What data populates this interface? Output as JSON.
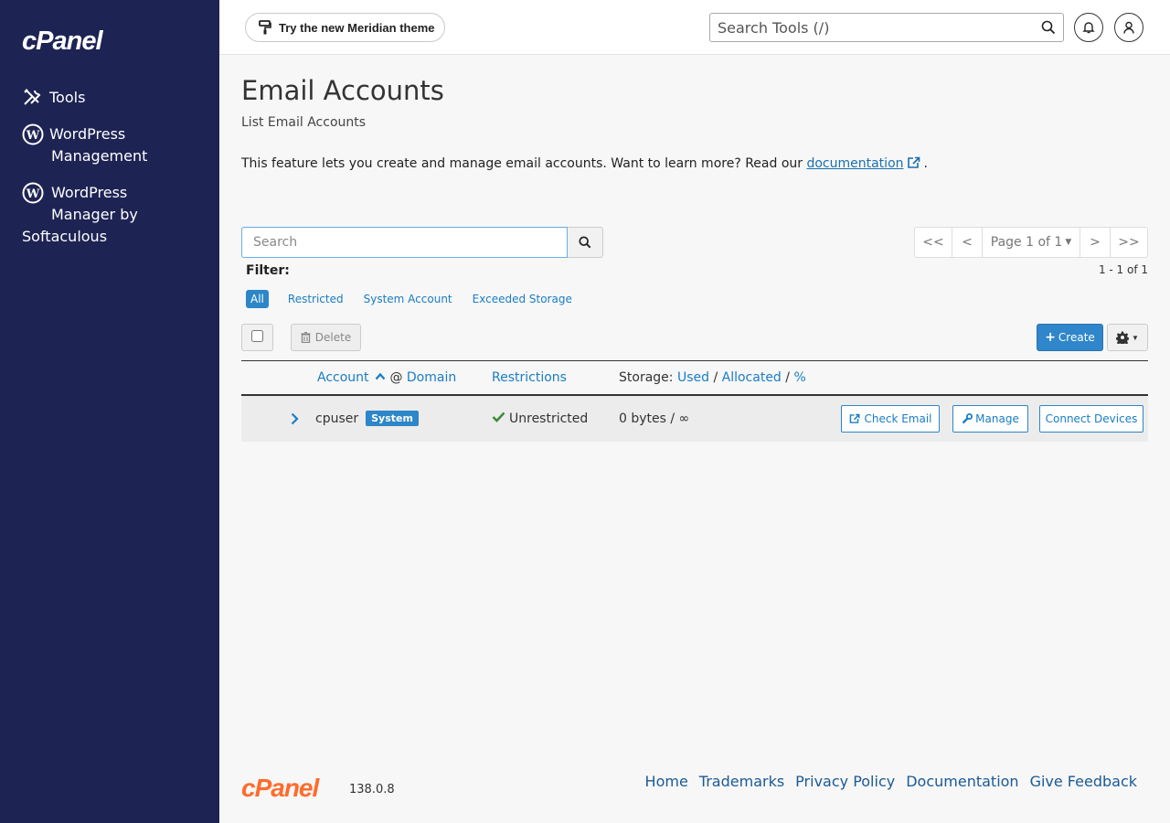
{
  "brand": {
    "logo_text": "cPanel",
    "version": "138.0.8"
  },
  "sidebar": {
    "items": [
      {
        "label": "Tools",
        "icon": "tools-icon"
      },
      {
        "label_line1": "WordPress",
        "label_line2": "Management",
        "icon": "wordpress-icon"
      },
      {
        "label_line1": "WordPress",
        "label_line2": "Manager by",
        "label_line3": "Softaculous",
        "icon": "wordpress-icon"
      }
    ]
  },
  "topbar": {
    "theme_button": "Try the new Meridian theme",
    "search_placeholder": "Search Tools (/)"
  },
  "page": {
    "title": "Email Accounts",
    "subtitle": "List Email Accounts",
    "intro_text": "This feature lets you create and manage email accounts. Want to learn more? Read our ",
    "intro_link": "documentation",
    "intro_end": "."
  },
  "list": {
    "search_placeholder": "Search",
    "pager": {
      "first": "<<",
      "prev": "<",
      "page_label": "Page 1 of 1",
      "next": ">",
      "last": ">>"
    },
    "results_count": "1 - 1 of 1",
    "filter_label": "Filter:",
    "filters": [
      "All",
      "Restricted",
      "System Account",
      "Exceeded Storage"
    ],
    "active_filter": "All",
    "delete_label": "Delete",
    "create_label": "Create",
    "headers": {
      "account": "Account",
      "at": "@",
      "domain": "Domain",
      "restrictions": "Restrictions",
      "storage_prefix": "Storage:",
      "used": "Used",
      "slash1": "/",
      "allocated": "Allocated",
      "slash2": "/",
      "percent": "%"
    },
    "rows": [
      {
        "account": "cpuser",
        "badge": "System",
        "restriction": "Unrestricted",
        "storage": "0 bytes / ∞",
        "actions": {
          "check_email": "Check Email",
          "manage": "Manage",
          "connect": "Connect Devices"
        }
      }
    ]
  },
  "footer": {
    "links": [
      "Home",
      "Trademarks",
      "Privacy Policy",
      "Documentation",
      "Give Feedback"
    ]
  },
  "colors": {
    "sidebar_bg": "#1d2353",
    "accent": "#2d86c7",
    "logo_orange": "#ff6c2c"
  }
}
